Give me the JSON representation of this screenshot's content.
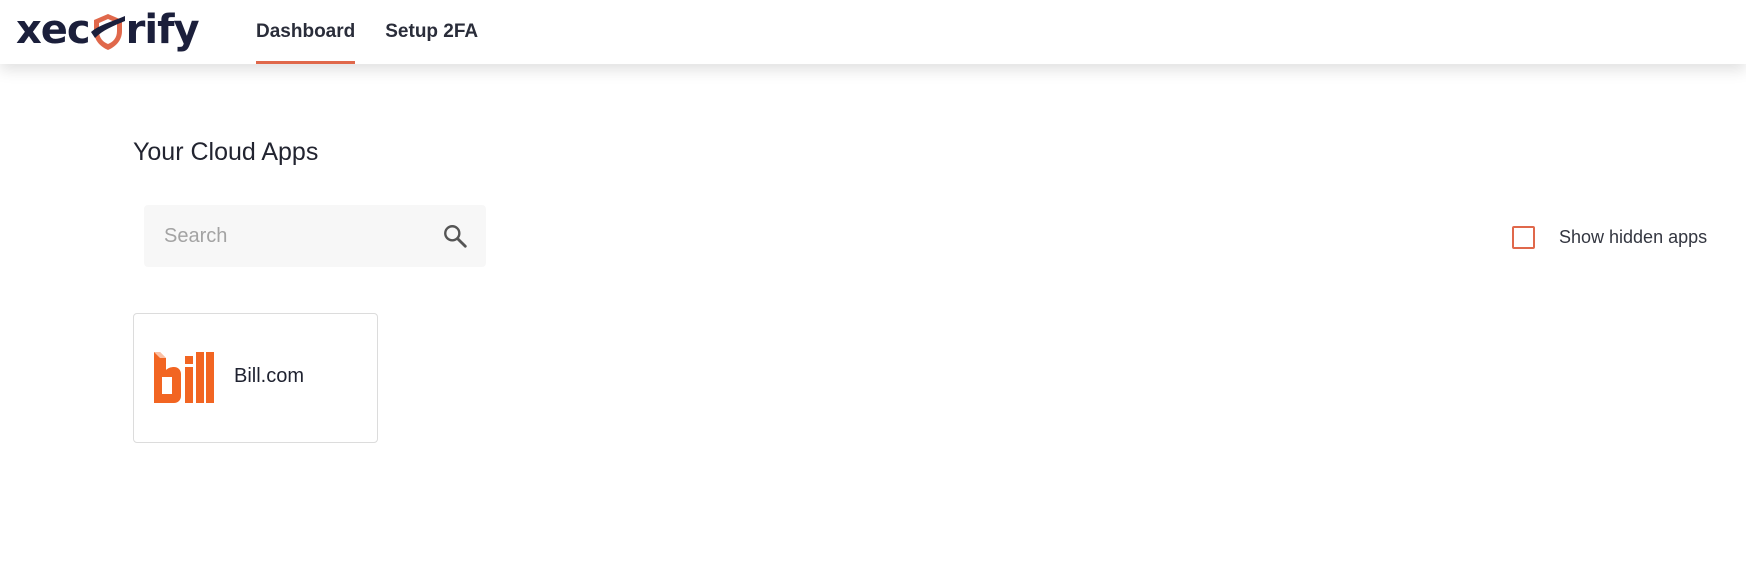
{
  "brand": {
    "name_left": "xec",
    "name_right": "rify",
    "accent_color": "#e0684b",
    "text_color": "#1b1f3b"
  },
  "nav": {
    "tabs": [
      {
        "label": "Dashboard",
        "active": true
      },
      {
        "label": "Setup 2FA",
        "active": false
      }
    ]
  },
  "main": {
    "title": "Your Cloud Apps",
    "search": {
      "placeholder": "Search",
      "value": ""
    },
    "show_hidden": {
      "label": "Show hidden apps",
      "checked": false
    },
    "apps": [
      {
        "name": "Bill.com",
        "logo_text": "bill",
        "logo_color": "#f26522"
      }
    ]
  }
}
